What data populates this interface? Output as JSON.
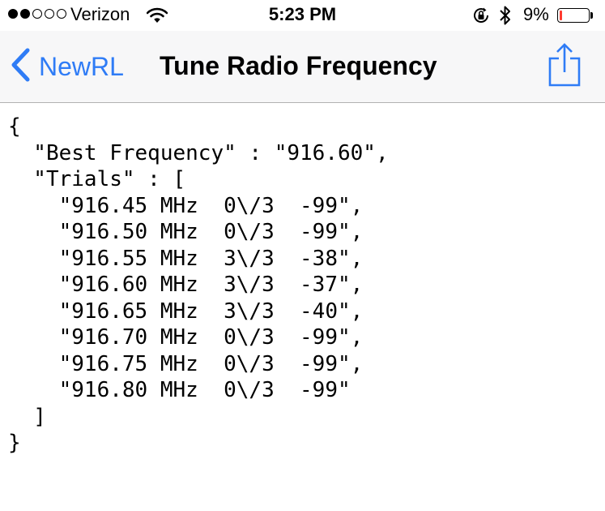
{
  "status_bar": {
    "carrier": "Verizon",
    "signal_bars_filled": 2,
    "signal_bars_total": 5,
    "time": "5:23 PM",
    "battery_percent": "9%",
    "battery_level": 0.09,
    "battery_color": "#ff3b30",
    "icons": [
      "wifi-icon",
      "rotation-lock-icon",
      "bluetooth-icon",
      "battery-icon"
    ]
  },
  "nav": {
    "back_label": "NewRL",
    "title": "Tune Radio Frequency",
    "accent_color": "#2f7cf6",
    "icons": [
      "chevron-left-icon",
      "share-icon"
    ]
  },
  "content": {
    "lines": [
      "{",
      "  \"Best Frequency\" : \"916.60\",",
      "  \"Trials\" : [",
      "    \"916.45 MHz  0\\/3  -99\",",
      "    \"916.50 MHz  0\\/3  -99\",",
      "    \"916.55 MHz  3\\/3  -38\",",
      "    \"916.60 MHz  3\\/3  -37\",",
      "    \"916.65 MHz  3\\/3  -40\",",
      "    \"916.70 MHz  0\\/3  -99\",",
      "    \"916.75 MHz  0\\/3  -99\",",
      "    \"916.80 MHz  0\\/3  -99\"",
      "  ]",
      "}"
    ]
  }
}
